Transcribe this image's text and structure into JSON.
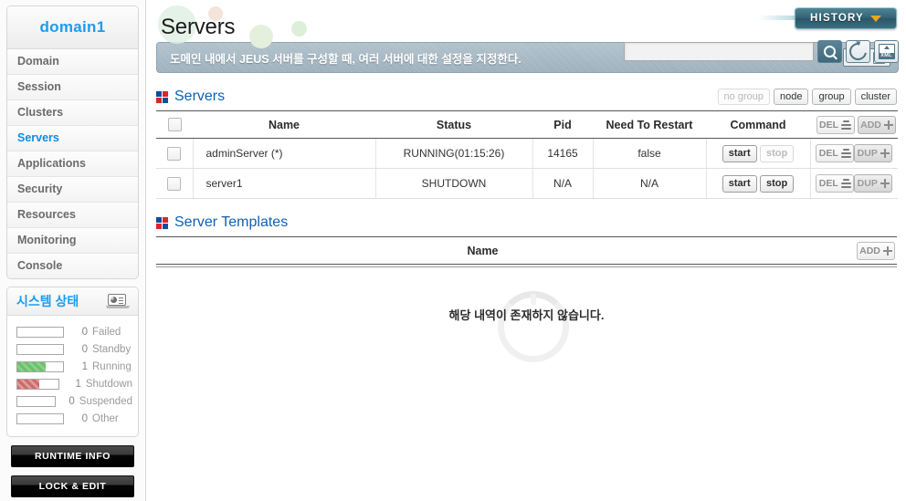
{
  "sidebar": {
    "domain_title": "domain1",
    "nav_items": [
      {
        "label": "Domain",
        "active": false
      },
      {
        "label": "Session",
        "active": false
      },
      {
        "label": "Clusters",
        "active": false
      },
      {
        "label": "Servers",
        "active": true
      },
      {
        "label": "Applications",
        "active": false
      },
      {
        "label": "Security",
        "active": false
      },
      {
        "label": "Resources",
        "active": false
      },
      {
        "label": "Monitoring",
        "active": false
      },
      {
        "label": "Console",
        "active": false
      }
    ],
    "status": {
      "title": "시스템 상태",
      "icon": "monitor-chart-icon",
      "rows": [
        {
          "count": "0",
          "label": "Failed",
          "fill": 0,
          "color": "none"
        },
        {
          "count": "0",
          "label": "Standby",
          "fill": 0,
          "color": "none"
        },
        {
          "count": "1",
          "label": "Running",
          "fill": 62,
          "color": "green"
        },
        {
          "count": "1",
          "label": "Shutdown",
          "fill": 52,
          "color": "red"
        },
        {
          "count": "0",
          "label": "Suspended",
          "fill": 0,
          "color": "none"
        },
        {
          "count": "0",
          "label": "Other",
          "fill": 0,
          "color": "none"
        }
      ]
    },
    "runtime_info_label": "RUNTIME INFO",
    "lock_edit_label": "LOCK & EDIT"
  },
  "header": {
    "page_title": "Servers",
    "history_label": "HISTORY",
    "history_chevron": "chevron-down-icon",
    "search_value": "",
    "search_placeholder": "",
    "tools": [
      {
        "name": "search-icon",
        "title": "search"
      },
      {
        "name": "refresh-icon",
        "title": "refresh"
      },
      {
        "name": "xml-export-icon",
        "title": "XML"
      }
    ]
  },
  "infobar": {
    "text": "도메인 내에서 JEUS 서버를 구성할 때, 여러 서버에 대한 설정을 지정한다.",
    "help_label": "Help",
    "help_mark": "?"
  },
  "servers_section": {
    "title": "Servers",
    "group_buttons": [
      {
        "label": "no group",
        "disabled": true
      },
      {
        "label": "node",
        "disabled": false
      },
      {
        "label": "group",
        "disabled": false
      },
      {
        "label": "cluster",
        "disabled": false
      }
    ],
    "columns": [
      "",
      "Name",
      "Status",
      "Pid",
      "Need To Restart",
      "Command"
    ],
    "header_actions": [
      {
        "label": "DEL",
        "icon": "stack-icon",
        "style": "dim"
      },
      {
        "label": "ADD",
        "icon": "plus-icon",
        "style": "strong"
      }
    ],
    "rows": [
      {
        "name": "adminServer (*)",
        "status": "RUNNING(01:15:26)",
        "pid": "14165",
        "need_to_restart": "false",
        "start_label": "start",
        "stop_label": "stop",
        "start_enabled": true,
        "stop_enabled": false,
        "del_label": "DEL",
        "dup_label": "DUP"
      },
      {
        "name": "server1",
        "status": "SHUTDOWN",
        "pid": "N/A",
        "need_to_restart": "N/A",
        "start_label": "start",
        "stop_label": "stop",
        "start_enabled": true,
        "stop_enabled": true,
        "del_label": "DEL",
        "dup_label": "DUP"
      }
    ]
  },
  "templates_section": {
    "title": "Server Templates",
    "column_name": "Name",
    "add_label": "ADD",
    "empty_message": "해당 내역이 존재하지 않습니다."
  },
  "colors": {
    "accent_blue": "#1b9cf0",
    "section_blue": "#1060b4",
    "history_teal": "#326274",
    "chevron_orange": "#f0a31e",
    "running_green": "#6cc06c",
    "shutdown_red": "#cf6a6a",
    "infobar_gray": "#9bb0bd"
  }
}
